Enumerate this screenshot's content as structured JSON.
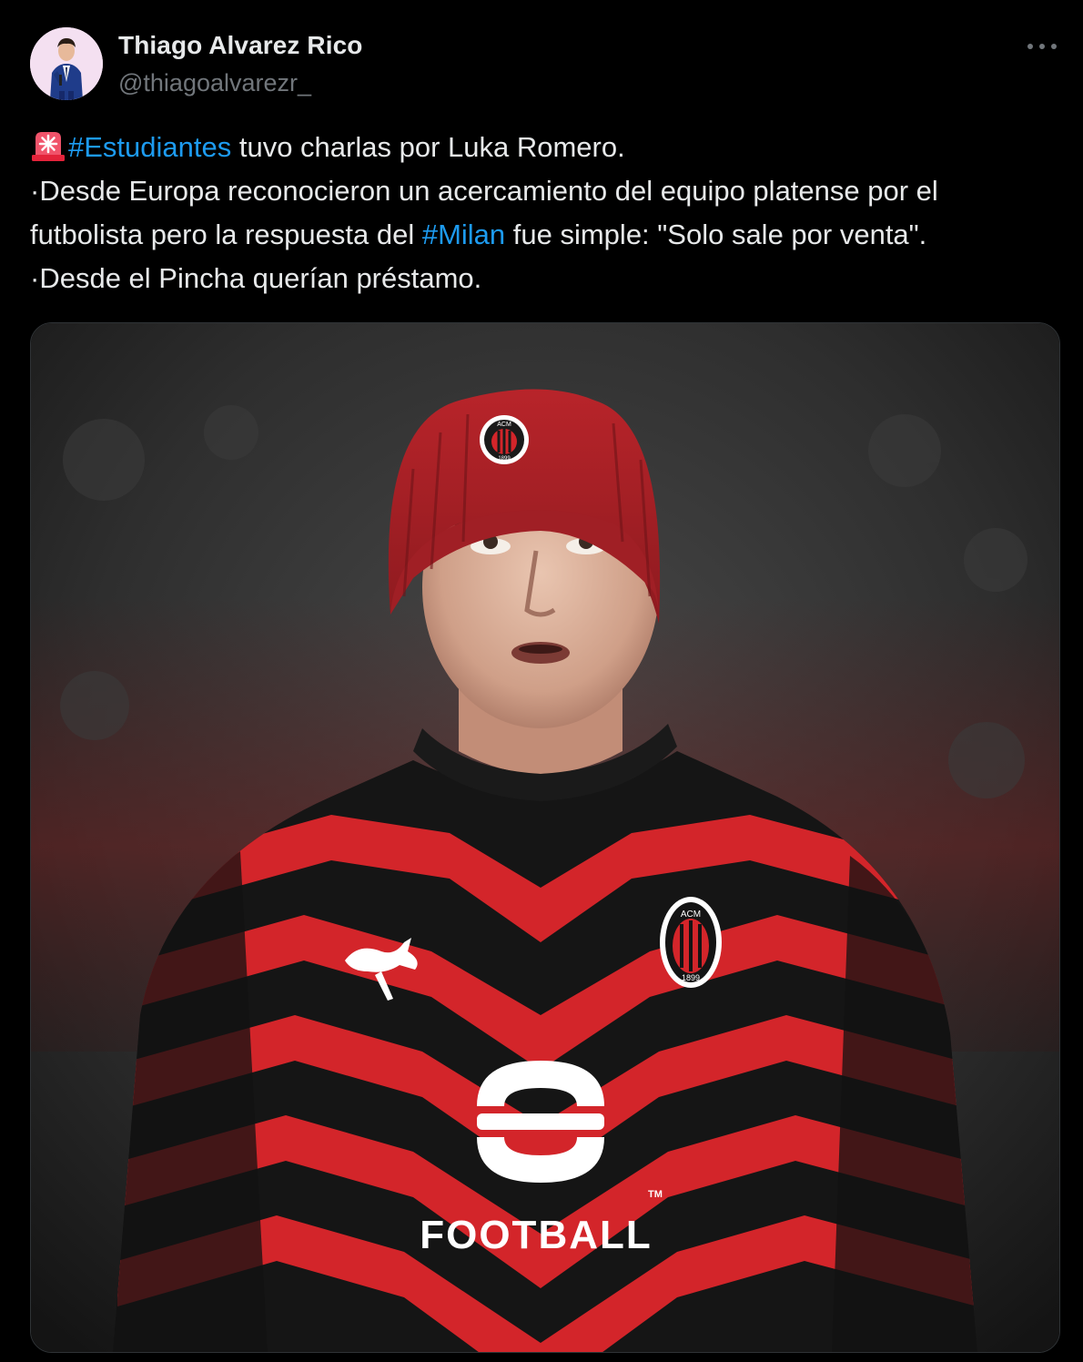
{
  "author": {
    "display_name": "Thiago Alvarez Rico",
    "handle": "@thiagoalvarezr_",
    "avatar_icon": "person-avatar-icon"
  },
  "more_icon": "more-options-icon",
  "tweet": {
    "line1": {
      "emoji": "rotating-light-emoji",
      "hashtag": "#Estudiantes",
      "text": " tuvo charlas por Luka Romero."
    },
    "line2": "·Desde Europa reconocieron un acercamiento del equipo platense por el",
    "line3": {
      "before": "futbolista pero la respuesta del ",
      "hashtag": "#Milan",
      "after": " fue simple: \"Solo sale por venta\"."
    },
    "line4": "·Desde el Pincha querían préstamo."
  },
  "media": {
    "description_icon": "player-photo",
    "cap_badge_text": "ACM",
    "cap_badge_year": "1899",
    "chest_badge_text": "ACM",
    "chest_badge_year": "1899",
    "sponsor": "FOOTBALL",
    "trademark": "TM",
    "colors": {
      "red": "#d3252a",
      "black": "#141414",
      "background": "#2b2b2b"
    }
  },
  "colors": {
    "background": "#000000",
    "text": "#e7e9ea",
    "secondary": "#71767b",
    "link": "#1d9bf0"
  }
}
